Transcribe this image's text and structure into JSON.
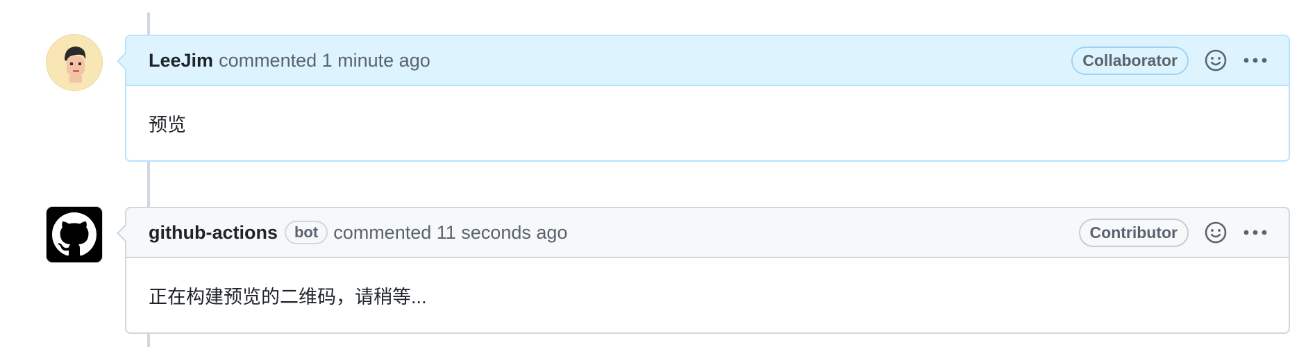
{
  "comments": [
    {
      "author": "LeeJim",
      "meta": "commented 1 minute ago",
      "role": "Collaborator",
      "body": "预览",
      "avatar": "user-avatar-icon"
    },
    {
      "author": "github-actions",
      "badge": "bot",
      "meta": "commented 11 seconds ago",
      "role": "Contributor",
      "body": "正在构建预览的二维码，请稍等...",
      "avatar": "github-logo-icon"
    }
  ],
  "colors": {
    "highlight_header": "#ddf4ff",
    "highlight_border": "#b6e3ff",
    "header": "#f6f8fa",
    "border": "#d0d7de"
  }
}
